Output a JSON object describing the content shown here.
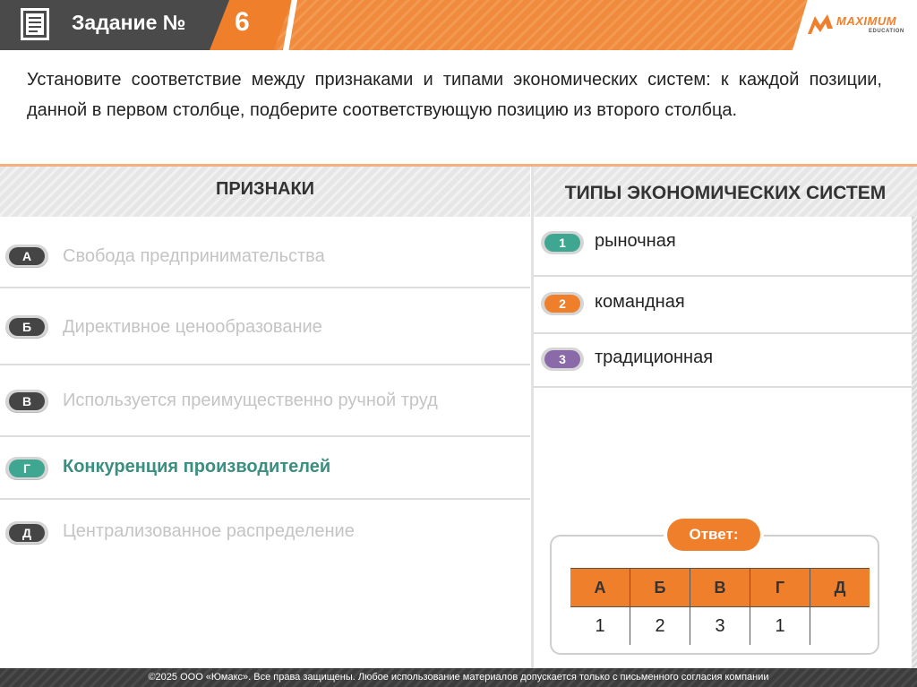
{
  "header": {
    "title": "Задание №",
    "task_number": "6",
    "logo_text": "MAXIMUM",
    "logo_sub": "EDUCATION"
  },
  "question": "Установите соответствие между признаками и типами экономических систем: к каждой позиции, данной в первом столбце, подберите соответствующую позицию из второго столбца.",
  "columns": {
    "left_title": "ПРИЗНАКИ",
    "right_title": "ТИПЫ ЭКОНОМИЧЕСКИХ СИСТЕМ"
  },
  "features": [
    {
      "letter": "А",
      "text": "Свобода предпринимательства",
      "active": false
    },
    {
      "letter": "Б",
      "text": "Директивное ценообразование",
      "active": false
    },
    {
      "letter": "В",
      "text": "Используется преимущественно ручной труд",
      "active": false
    },
    {
      "letter": "Г",
      "text": "Конкуренция производителей",
      "active": true
    },
    {
      "letter": "Д",
      "text": "Централизованное распределение",
      "active": false
    }
  ],
  "types": [
    {
      "number": "1",
      "text": "рыночная",
      "color": "#3fa692"
    },
    {
      "number": "2",
      "text": "командная",
      "color": "#f07f2c"
    },
    {
      "number": "3",
      "text": "традиционная",
      "color": "#8a6aa8"
    }
  ],
  "answer": {
    "label": "Ответ:",
    "headers": [
      "А",
      "Б",
      "В",
      "Г",
      "Д"
    ],
    "values": [
      "1",
      "2",
      "3",
      "1",
      ""
    ]
  },
  "footer": "©2025 ООО «Юмакс». Все права защищены. Любое использование материалов допускается только с  письменного согласия компании"
}
